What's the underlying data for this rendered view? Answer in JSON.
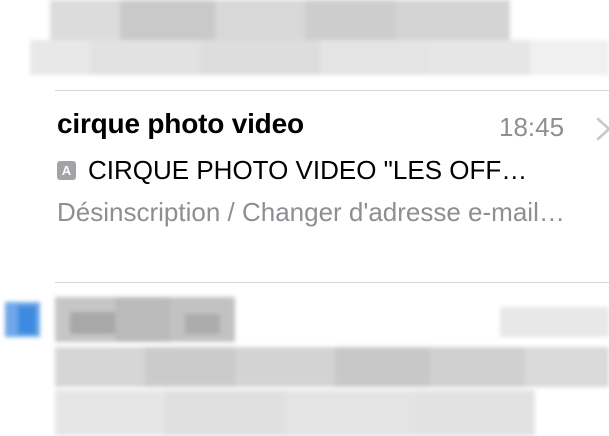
{
  "mail_item": {
    "sender": "cirque photo video",
    "time": "18:45",
    "recipient_badge": "A",
    "subject": "CIRQUE PHOTO VIDEO \"LES OFF…",
    "preview": "Désinscription / Changer d'adresse e-mail…"
  },
  "colors": {
    "sender_text": "#000000",
    "secondary_text": "#8e8e93",
    "separator": "#d6d6d9",
    "unread_dot": "#4a90e2"
  },
  "icons": {
    "disclosure": "chevron-right-icon",
    "recipient": "to-me-badge-icon"
  }
}
